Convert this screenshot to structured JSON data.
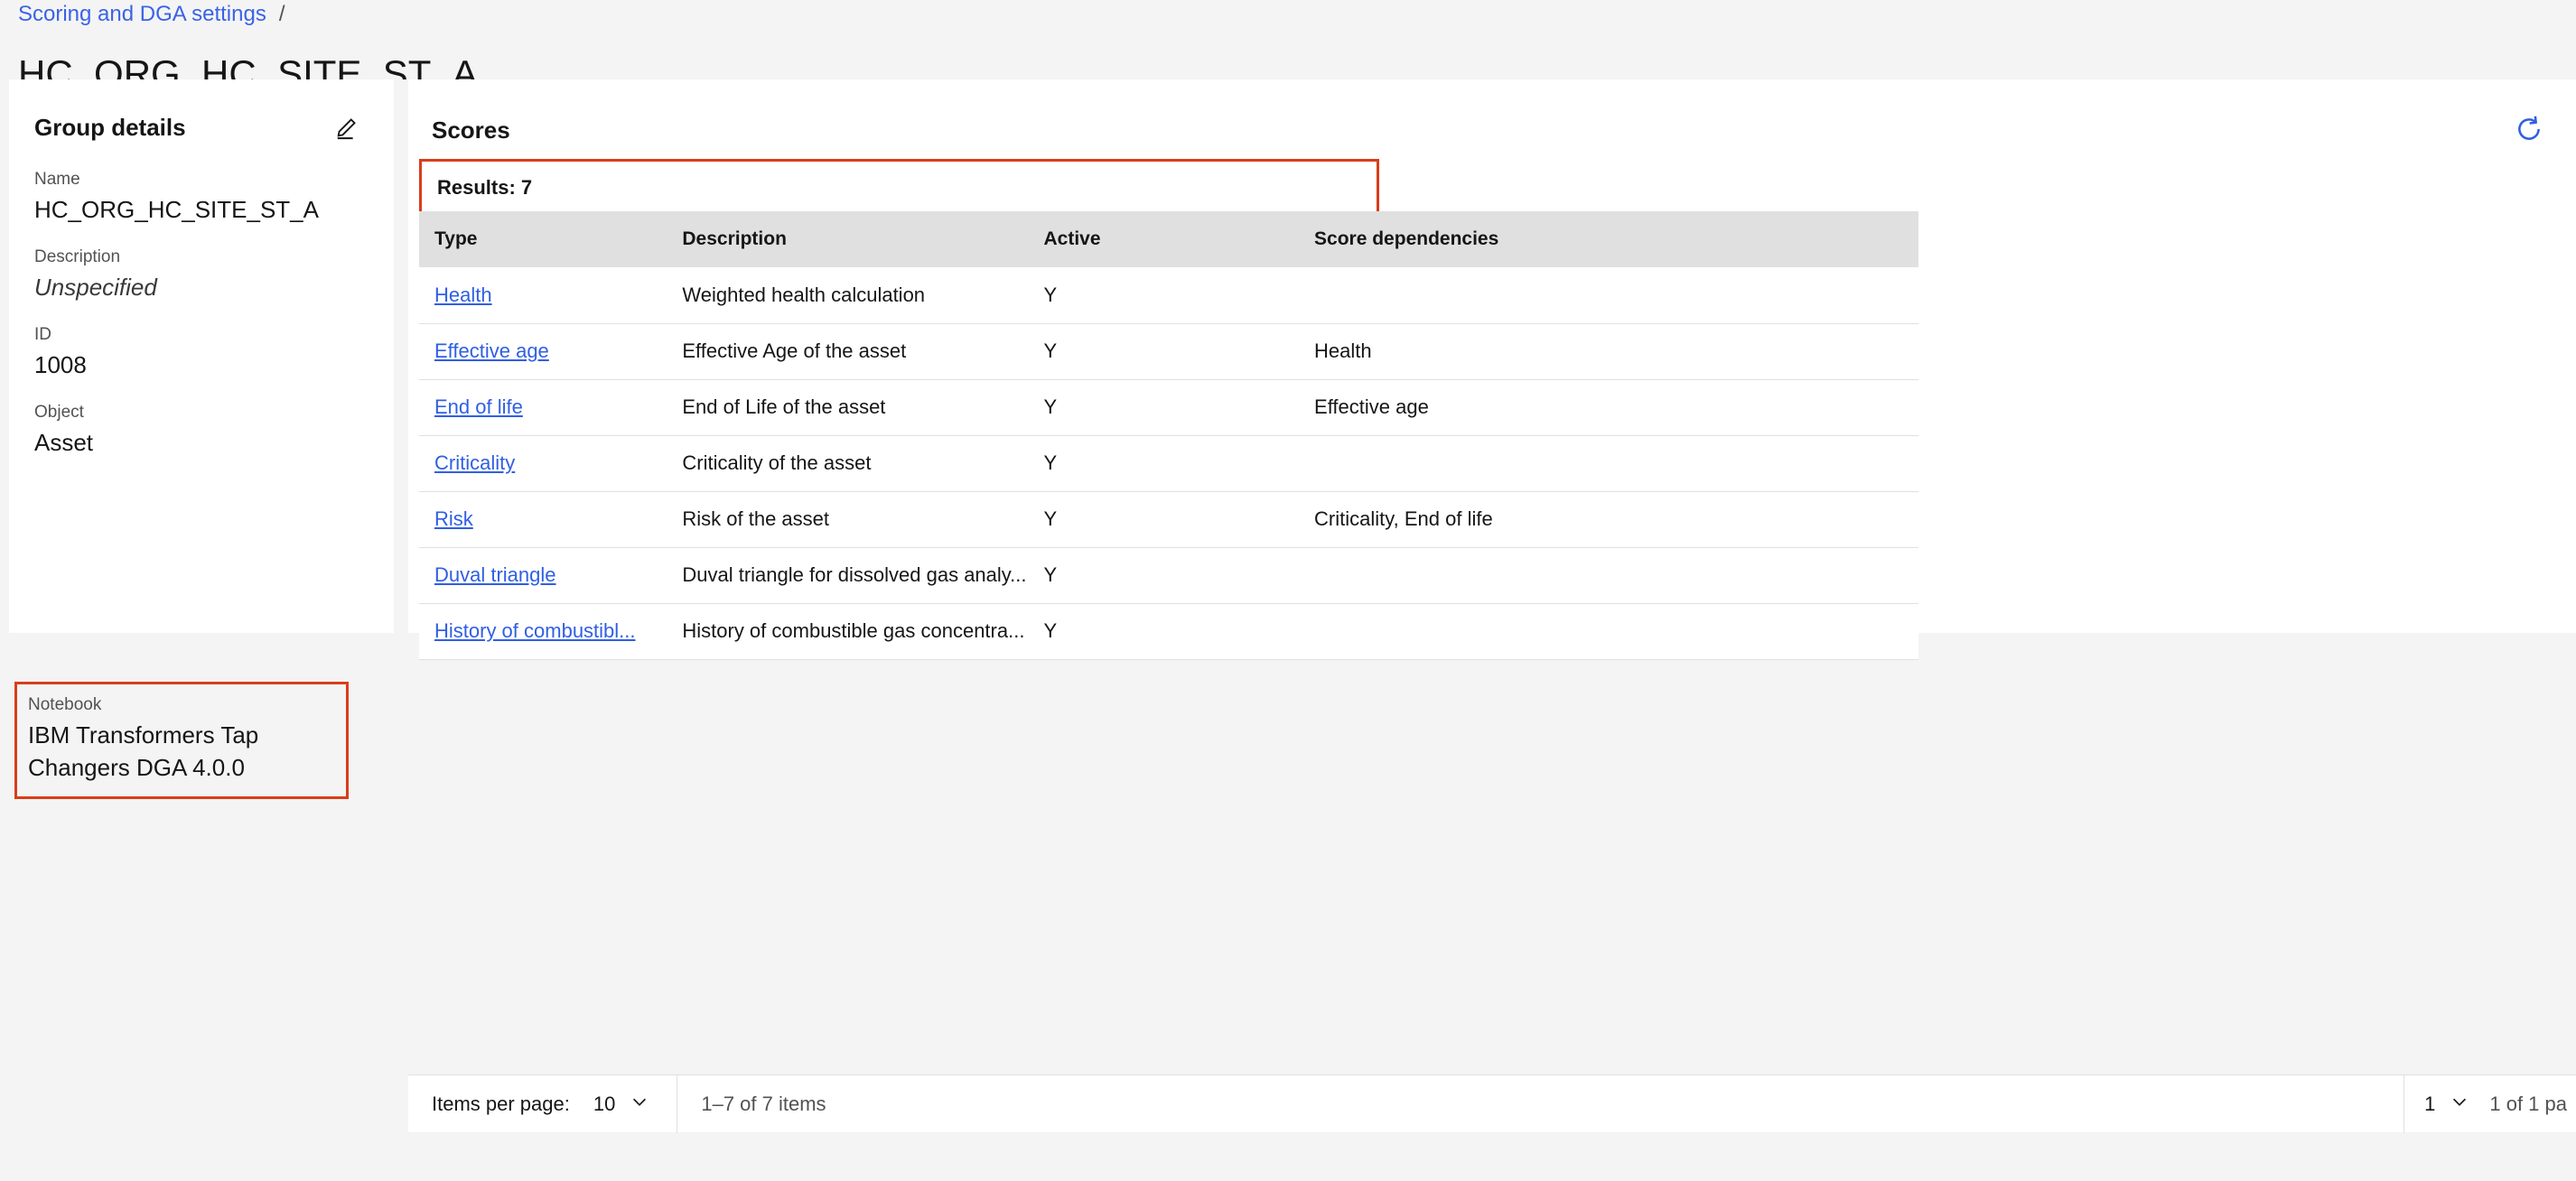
{
  "breadcrumb": {
    "link_label": "Scoring and DGA settings",
    "separator": "/"
  },
  "page_title": "HC_ORG_HC_SITE_ST_A",
  "group_details": {
    "title": "Group details",
    "edit_icon": "pencil-icon",
    "fields": [
      {
        "label": "Name",
        "value": "HC_ORG_HC_SITE_ST_A",
        "italic": false
      },
      {
        "label": "Description",
        "value": "Unspecified",
        "italic": true
      },
      {
        "label": "ID",
        "value": "1008",
        "italic": false
      },
      {
        "label": "Object",
        "value": "Asset",
        "italic": false
      }
    ],
    "notebook": {
      "label": "Notebook",
      "value": "IBM Transformers Tap Changers DGA 4.0.0",
      "highlight_color": "#d93d1a"
    }
  },
  "scores_panel": {
    "title": "Scores",
    "refresh_icon": "refresh-icon",
    "refresh_color": "#2f5fe3",
    "results_label": "Results: 7",
    "columns": [
      "Type",
      "Description",
      "Active",
      "Score dependencies"
    ],
    "rows": [
      {
        "type": "Health",
        "description": "Weighted health calculation",
        "active": "Y",
        "dependencies": ""
      },
      {
        "type": "Effective age",
        "description": "Effective Age of the asset",
        "active": "Y",
        "dependencies": "Health"
      },
      {
        "type": "End of life",
        "description": "End of Life of the asset",
        "active": "Y",
        "dependencies": "Effective age"
      },
      {
        "type": "Criticality",
        "description": "Criticality of the asset",
        "active": "Y",
        "dependencies": ""
      },
      {
        "type": "Risk",
        "description": "Risk of the asset",
        "active": "Y",
        "dependencies": "Criticality, End of life"
      },
      {
        "type": "Duval triangle",
        "description": "Duval triangle for dissolved gas analy...",
        "active": "Y",
        "dependencies": ""
      },
      {
        "type": "History of combustibl...",
        "description": "History of combustible gas concentra...",
        "active": "Y",
        "dependencies": ""
      }
    ],
    "highlight_color": "#d93d1a"
  },
  "pagination": {
    "items_per_page_label": "Items per page:",
    "items_per_page_value": "10",
    "range_label": "1–7 of 7 items",
    "page_value": "1",
    "page_of_label": "1 of 1 pa"
  }
}
